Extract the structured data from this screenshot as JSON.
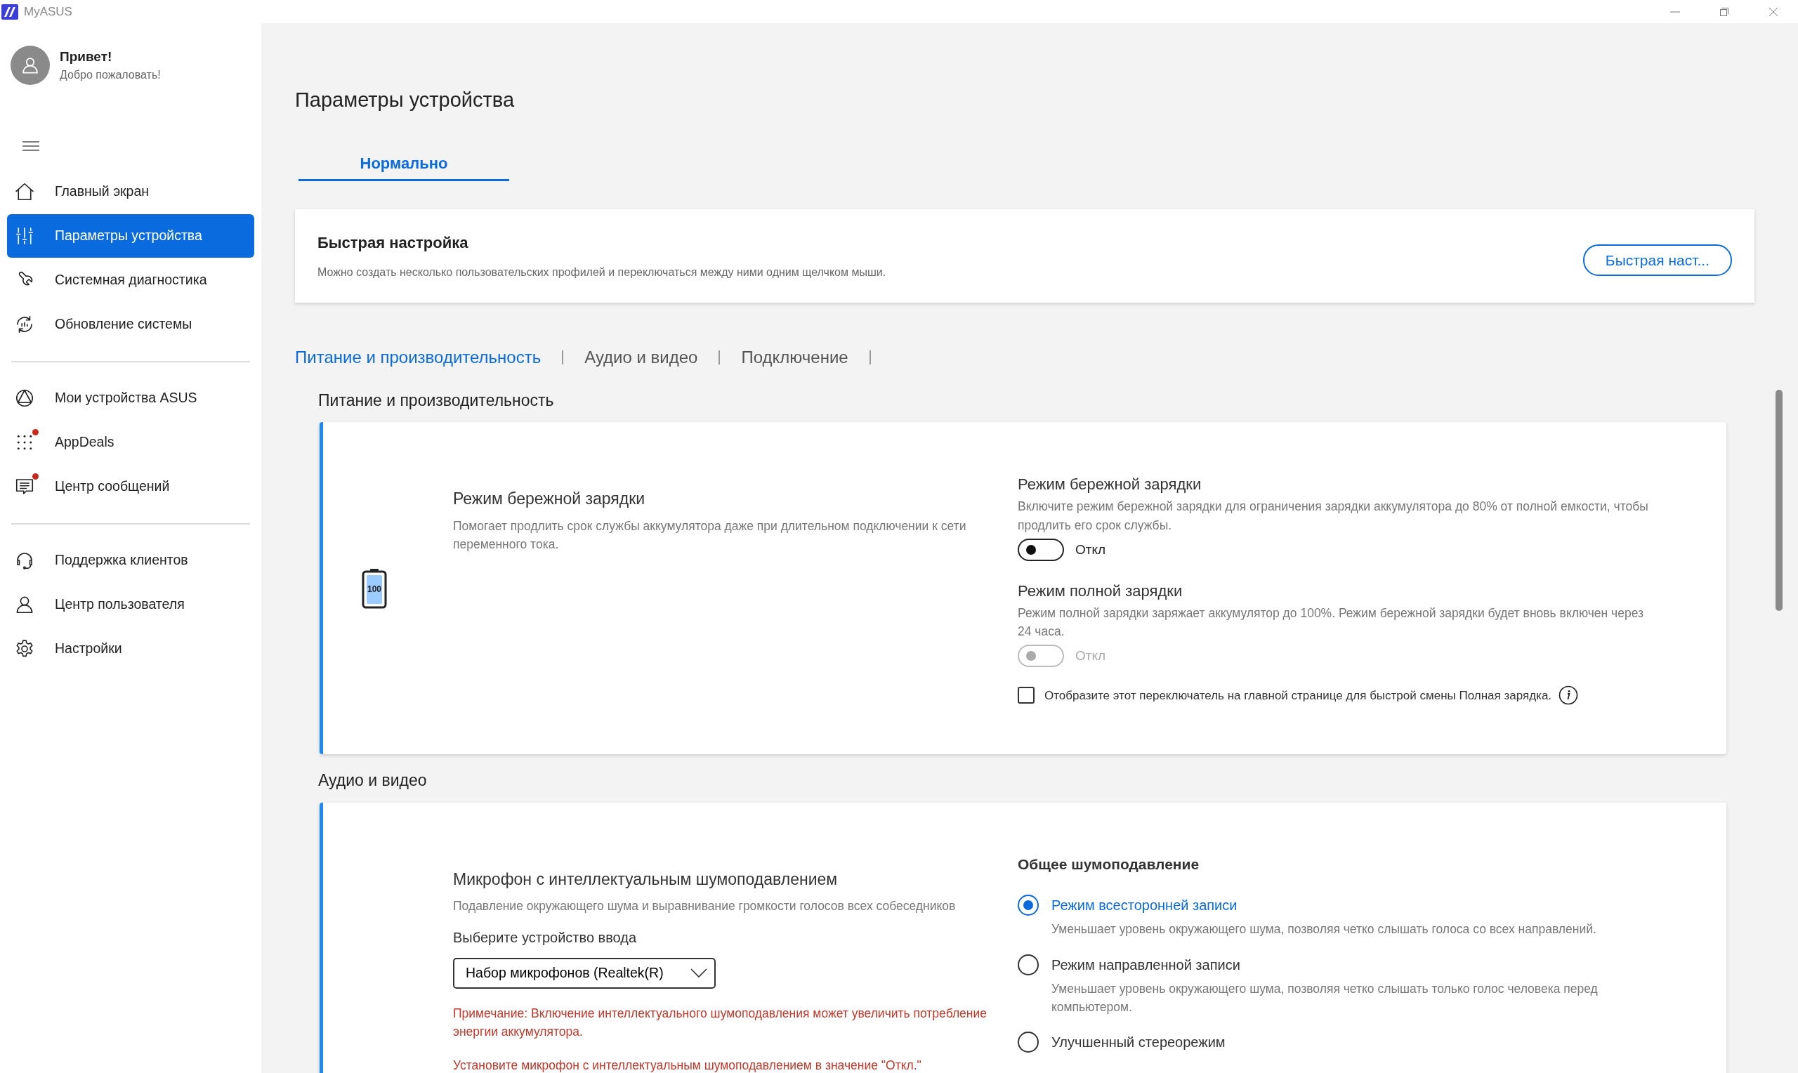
{
  "window": {
    "title": "MyASUS"
  },
  "user": {
    "greeting": "Привет!",
    "welcome": "Добро пожаловать!"
  },
  "sidebar": {
    "groups": [
      [
        {
          "label": "Главный экран",
          "kind": "home",
          "selected": false,
          "notification": false
        },
        {
          "label": "Параметры устройства",
          "kind": "sliders",
          "selected": true,
          "notification": false
        },
        {
          "label": "Системная диагностика",
          "kind": "wrench",
          "selected": false,
          "notification": false
        },
        {
          "label": "Обновление системы",
          "kind": "update",
          "selected": false,
          "notification": false
        }
      ],
      [
        {
          "label": "Мои устройства ASUS",
          "kind": "devices",
          "selected": false,
          "notification": false
        },
        {
          "label": "AppDeals",
          "kind": "dots",
          "selected": false,
          "notification": true
        },
        {
          "label": "Центр сообщений",
          "kind": "message",
          "selected": false,
          "notification": true
        }
      ],
      [
        {
          "label": "Поддержка клиентов",
          "kind": "headset",
          "selected": false,
          "notification": false
        },
        {
          "label": "Центр пользователя",
          "kind": "user",
          "selected": false,
          "notification": false
        },
        {
          "label": "Настройки",
          "kind": "gear",
          "selected": false,
          "notification": false
        }
      ]
    ]
  },
  "page": {
    "title": "Параметры устройства"
  },
  "mode_tabs": [
    {
      "label": "Нормально",
      "selected": true
    }
  ],
  "quick_setup": {
    "title": "Быстрая настройка",
    "description": "Можно создать несколько пользовательских профилей и переключаться между ними одним щелчком мыши.",
    "button": "Быстрая наст..."
  },
  "section_tabs": [
    {
      "label": "Питание и производительность",
      "selected": true
    },
    {
      "label": "Аудио и видео",
      "selected": false
    },
    {
      "label": "Подключение",
      "selected": false
    }
  ],
  "power": {
    "heading": "Питание и производительность",
    "battery_label": "100",
    "title": "Режим бережной зарядки",
    "description": "Помогает продлить срок службы аккумулятора даже при длительном подключении к сети переменного тока.",
    "settings": [
      {
        "title": "Режим бережной зарядки",
        "description": "Включите режим бережной зарядки для ограничения зарядки аккумулятора до 80% от полной емкости, чтобы продлить его срок службы.",
        "on": false,
        "disabled": false,
        "state_label": "Откл"
      },
      {
        "title": "Режим полной зарядки",
        "description": "Режим полной зарядки заряжает аккумулятор до 100%. Режим бережной зарядки будет вновь включен через 24 часа.",
        "on": false,
        "disabled": true,
        "state_label": "Откл"
      }
    ],
    "checkbox": {
      "label": "Отобразите этот переключатель на главной странице для быстрой смены Полная зарядка.",
      "checked": false
    }
  },
  "audio": {
    "heading": "Аудио и видео",
    "title": "Микрофон с интеллектуальным шумоподавлением",
    "description": "Подавление окружающего шума и выравнивание громкости голосов всех собеседников",
    "input_label": "Выберите устройство ввода",
    "input_value": "Набор микрофонов (Realtek(R)",
    "notes": [
      "Примечание: Включение интеллектуального шумоподавления может увеличить потребление энергии аккумулятора.",
      "Установите микрофон с интеллектуальным шумоподавлением в значение \"Откл.\""
    ],
    "options_title": "Общее шумоподавление",
    "options": [
      {
        "label": "Режим всесторонней записи",
        "description": "Уменьшает уровень окружающего шума, позволяя четко слышать голоса со всех направлений.",
        "selected": true
      },
      {
        "label": "Режим направленной записи",
        "description": "Уменьшает уровень окружающего шума, позволяя четко слышать только голос человека перед компьютером.",
        "selected": false
      },
      {
        "label": "Улучшенный стереорежим",
        "selected": false
      }
    ]
  }
}
